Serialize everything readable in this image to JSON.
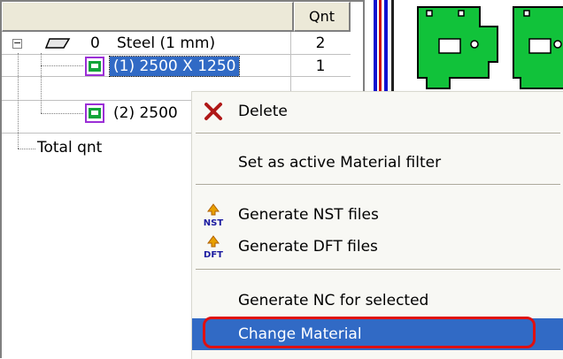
{
  "tree": {
    "header": {
      "name": "",
      "qnt": "Qnt"
    },
    "rows": [
      {
        "index": "0",
        "label": "Steel (1 mm)",
        "qnt": "2"
      },
      {
        "label": "(1) 2500 X 1250",
        "qnt": "1"
      },
      {
        "label": "(2) 2500",
        "qnt": ""
      },
      {
        "label": "Total qnt",
        "qnt": ""
      }
    ]
  },
  "menu": {
    "items": [
      {
        "label": "Delete",
        "icon": "delete-x-icon"
      },
      {
        "label": "Set as active Material filter",
        "icon": ""
      },
      {
        "label": "Generate NST files",
        "icon": "nst-icon"
      },
      {
        "label": "Generate DFT files",
        "icon": "dft-icon"
      },
      {
        "label": "Generate NC for selected",
        "icon": ""
      },
      {
        "label": "Change Material",
        "icon": ""
      }
    ],
    "icon_text": {
      "nst": "NST",
      "dft": "DFT"
    }
  },
  "colors": {
    "selection": "#316ac5",
    "highlight_ring": "#e01010",
    "part_green": "#11a53a",
    "sheet_border": "#9b2fd6"
  }
}
